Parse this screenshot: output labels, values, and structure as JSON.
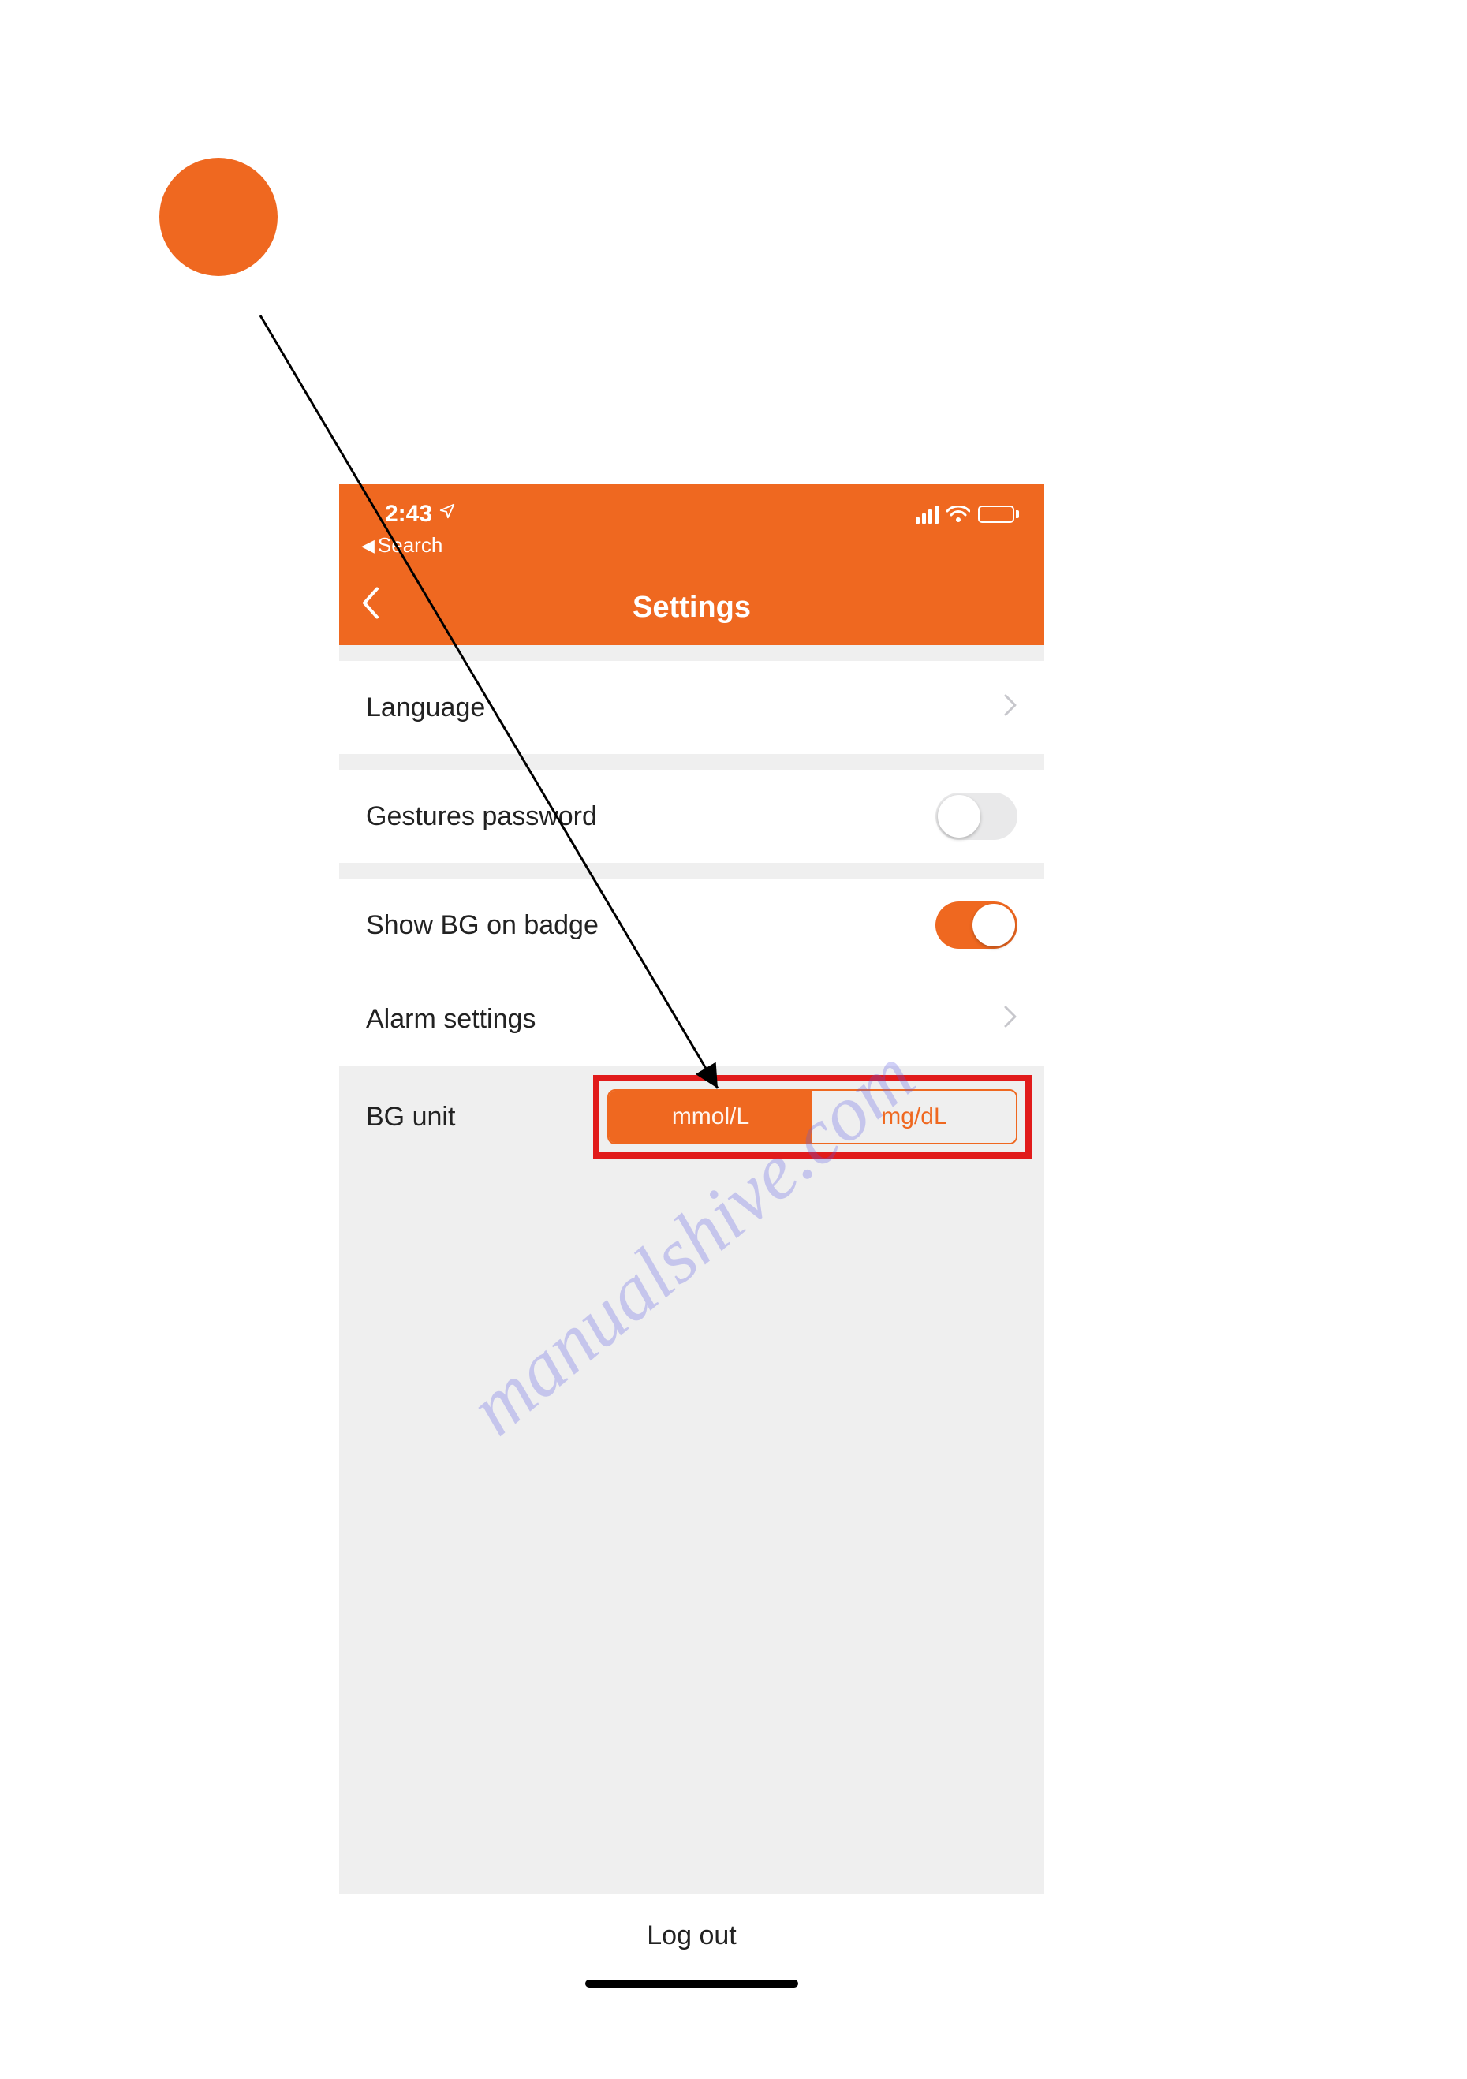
{
  "status": {
    "time": "2:43",
    "breadcrumb_label": "Search"
  },
  "nav": {
    "title": "Settings"
  },
  "rows": {
    "language": "Language",
    "gestures": "Gestures password",
    "show_badge": "Show BG on badge",
    "alarm": "Alarm settings",
    "bg_unit_label": "BG unit"
  },
  "toggles": {
    "gestures_password": false,
    "show_bg_on_badge": true
  },
  "bg_unit": {
    "options": [
      "mmol/L",
      "mg/dL"
    ],
    "selected": "mmol/L"
  },
  "footer": {
    "logout": "Log out"
  },
  "watermark": "manualshive.com"
}
